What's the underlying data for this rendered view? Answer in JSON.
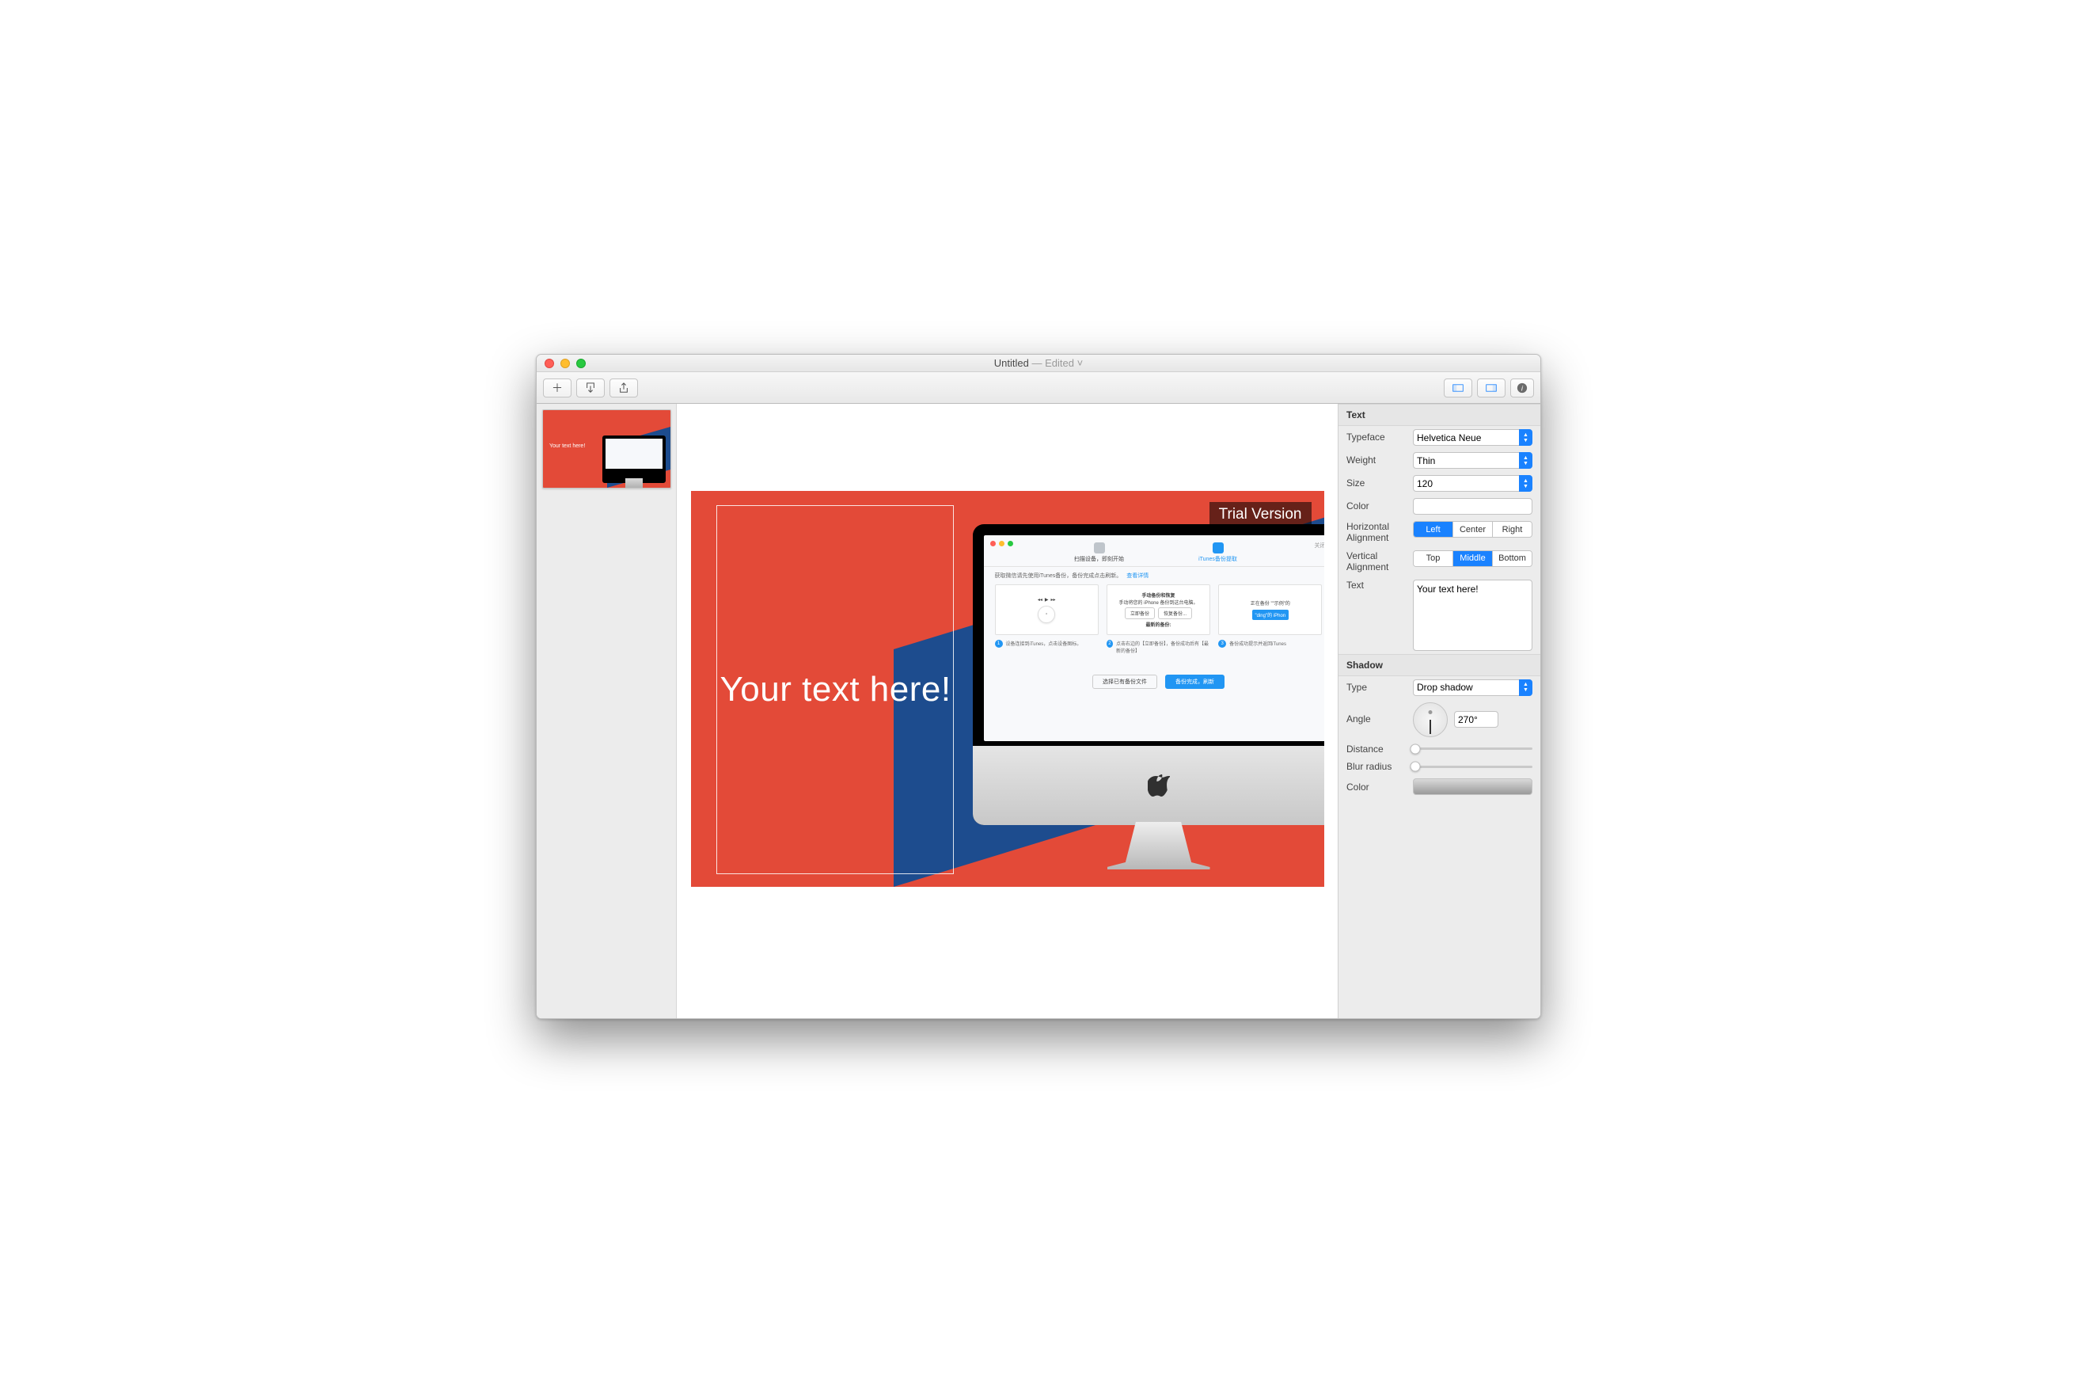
{
  "title": {
    "name": "Untitled",
    "status": "— Edited"
  },
  "canvas": {
    "trial_label": "Trial Version",
    "main_text": "Your text here!",
    "thumb_text": "Your text here!"
  },
  "inner_app": {
    "tab1": "扫描设备，即刻开始",
    "tab2": "iTunes备份提取",
    "menu_close": "关闭",
    "row1_instr": "获取微信请先使用iTunes备份，备份完成点击刷新。",
    "row1_link": "查看详情",
    "card2_title": "手动备份和恢复",
    "card2_sub": "手动将您的 iPhone 备份到这台电脑。",
    "card2_btn1": "立即备份",
    "card2_btn2": "恢复备份...",
    "card2_footer": "最新的备份:",
    "card3_top": "正在备份 \"\"示例\"的",
    "card3_bar": "\"ding\"的 iPhon",
    "step1": "设备连接到iTunes，点击设备图标。",
    "step2": "点击右边的【立即备份】，备份成功后有【最新的备份】",
    "step3": "备份成功提示并返回iTunes",
    "footer_btn1": "选择已有备份文件",
    "footer_btn2": "备份完成，刷新"
  },
  "inspector": {
    "text_section": "Text",
    "typeface_label": "Typeface",
    "typeface_value": "Helvetica Neue",
    "weight_label": "Weight",
    "weight_value": "Thin",
    "size_label": "Size",
    "size_value": "120",
    "color_label": "Color",
    "halign_label": "Horizontal Alignment",
    "halign": {
      "left": "Left",
      "center": "Center",
      "right": "Right",
      "selected": "Left"
    },
    "valign_label": "Vertical Alignment",
    "valign": {
      "top": "Top",
      "middle": "Middle",
      "bottom": "Bottom",
      "selected": "Middle"
    },
    "text_label": "Text",
    "text_value": "Your text here!",
    "shadow_section": "Shadow",
    "type_label": "Type",
    "type_value": "Drop shadow",
    "angle_label": "Angle",
    "angle_value": "270°",
    "distance_label": "Distance",
    "blur_label": "Blur radius",
    "shadow_color_label": "Color"
  }
}
